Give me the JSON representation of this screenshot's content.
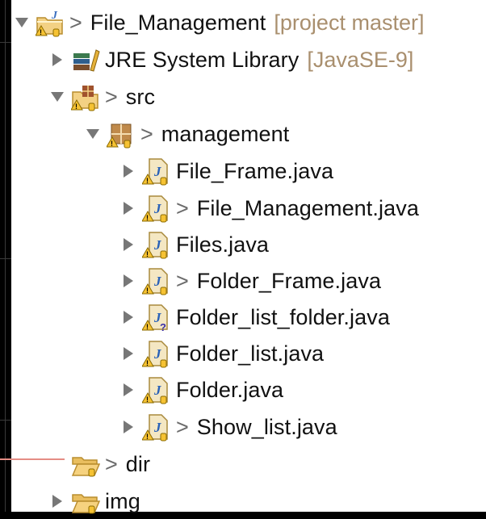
{
  "tree": {
    "project": {
      "dirty": ">",
      "name": "File_Management",
      "decoration": "[project master]"
    },
    "jre": {
      "name": "JRE System Library",
      "decoration": "[JavaSE-9]"
    },
    "src": {
      "dirty": ">",
      "name": "src"
    },
    "package": {
      "dirty": ">",
      "name": "management"
    },
    "files": [
      {
        "dirty": "",
        "name": "File_Frame.java"
      },
      {
        "dirty": ">",
        "name": "File_Management.java"
      },
      {
        "dirty": "",
        "name": "Files.java"
      },
      {
        "dirty": ">",
        "name": "Folder_Frame.java"
      },
      {
        "dirty": "",
        "name": "Folder_list_folder.java"
      },
      {
        "dirty": "",
        "name": "Folder_list.java"
      },
      {
        "dirty": "",
        "name": "Folder.java"
      },
      {
        "dirty": ">",
        "name": "Show_list.java"
      }
    ],
    "dir": {
      "dirty": ">",
      "name": "dir"
    },
    "img": {
      "name": "img"
    }
  }
}
